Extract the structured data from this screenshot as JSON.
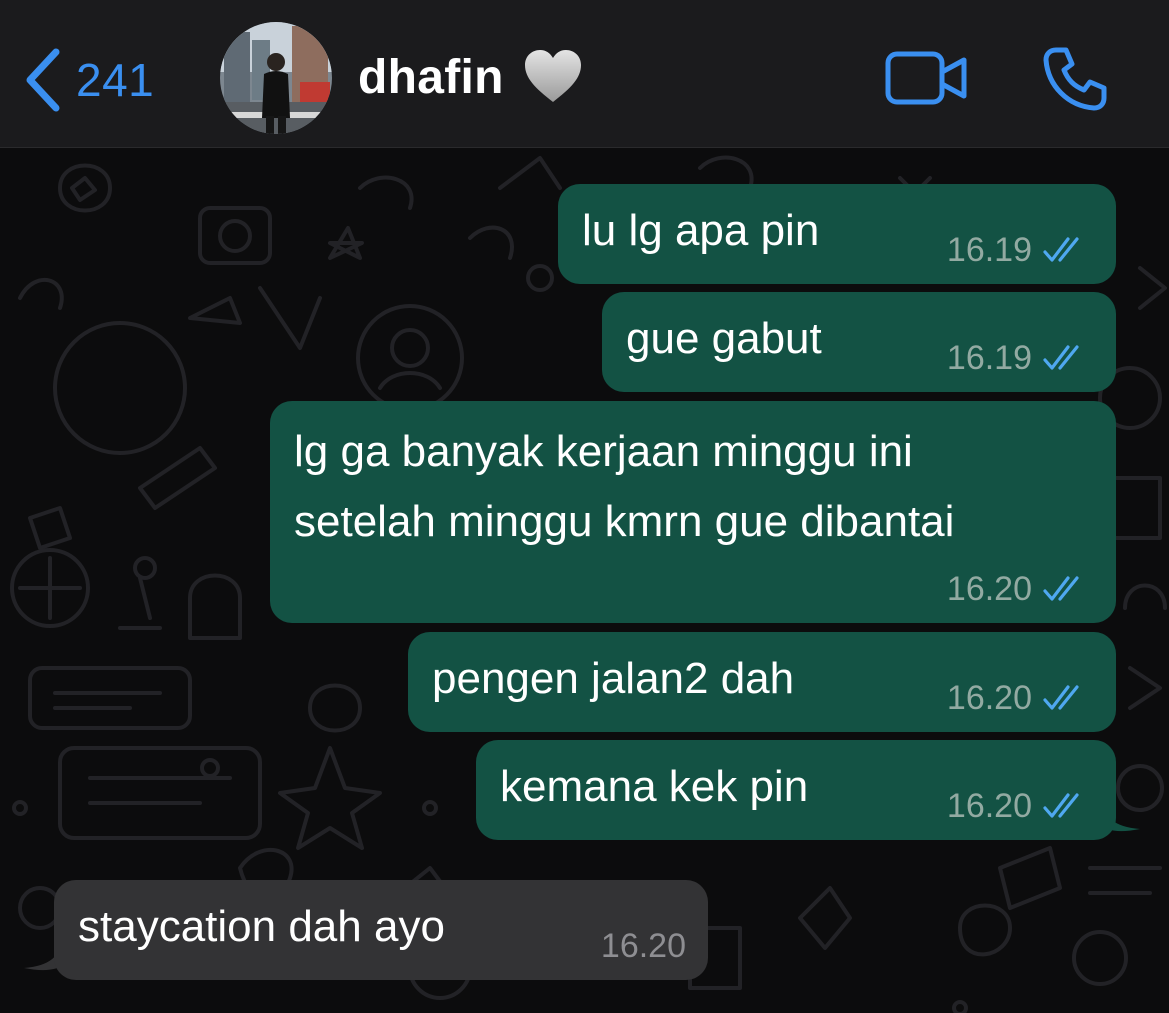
{
  "header": {
    "back_count": "241",
    "contact_name": "dhafin",
    "heart_emoji": "grey-heart",
    "accent_color": "#3a8ff0"
  },
  "messages": [
    {
      "direction": "outgoing",
      "text": "lu lg apa pin",
      "time": "16.19",
      "status": "read"
    },
    {
      "direction": "outgoing",
      "text": "gue gabut",
      "time": "16.19",
      "status": "read"
    },
    {
      "direction": "outgoing",
      "text": "lg ga banyak kerjaan minggu ini",
      "text_line2": "setelah minggu kmrn gue dibantai",
      "time": "16.20",
      "status": "read"
    },
    {
      "direction": "outgoing",
      "text": "pengen jalan2 dah",
      "time": "16.20",
      "status": "read"
    },
    {
      "direction": "outgoing",
      "text": "kemana kek pin",
      "time": "16.20",
      "status": "read"
    },
    {
      "direction": "incoming",
      "text": "staycation dah ayo",
      "time": "16.20"
    }
  ],
  "colors": {
    "outgoing_bubble": "#135244",
    "incoming_bubble": "#333335",
    "read_ticks": "#4fa8f0",
    "header_bg": "#1b1b1d"
  }
}
